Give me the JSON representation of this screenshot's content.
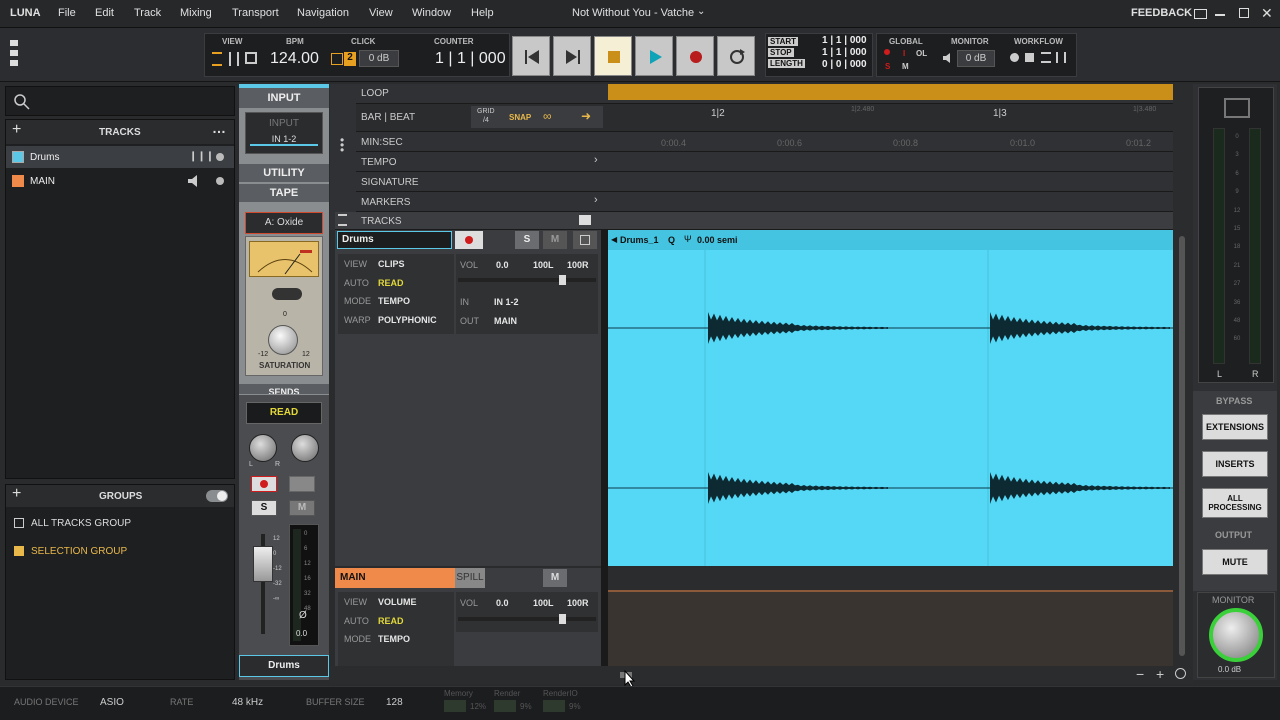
{
  "menu": {
    "app": "LUNA",
    "items": [
      "File",
      "Edit",
      "Track",
      "Mixing",
      "Transport",
      "Navigation",
      "View",
      "Window",
      "Help"
    ],
    "title": "Not Without You - Vatche",
    "feedback": "FEEDBACK"
  },
  "transport": {
    "view_label": "VIEW",
    "bpm_label": "BPM",
    "bpm": "124.00",
    "click_label": "CLICK",
    "click_value": "0 dB",
    "click_num": "2",
    "counter_label": "COUNTER",
    "counter": "1 | 1 | 000",
    "start_label": "START",
    "stop_label": "STOP",
    "length_label": "LENGTH",
    "start": "1 | 1 | 000",
    "stop": "1 | 1 | 000",
    "length": "0 | 0 | 000",
    "global_label": "GLOBAL",
    "global_s": "S",
    "global_m": "M",
    "global_i": "I",
    "global_ol": "OL",
    "monitor_label": "MONITOR",
    "monitor_value": "0 dB",
    "workflow_label": "WORKFLOW"
  },
  "left": {
    "tracks_header": "TRACKS",
    "tracks": [
      {
        "name": "Drums",
        "color": "#5bc8e8"
      },
      {
        "name": "MAIN",
        "color": "#f08a4b"
      }
    ],
    "groups_header": "GROUPS",
    "groups": [
      {
        "name": "ALL TRACKS GROUP",
        "color": "#dddddd"
      },
      {
        "name": "SELECTION GROUP",
        "color": "#e8b84a"
      }
    ]
  },
  "strip": {
    "input_label": "INPUT",
    "input_slot": "INPUT",
    "input_value": "IN 1-2",
    "utility_label": "UTILITY",
    "tape_label": "TAPE",
    "tape_name": "A: Oxide",
    "saturation_label": "SATURATION",
    "sat_min": "-12",
    "sat_max": "12",
    "sat_zero": "0",
    "sends_label": "SENDS",
    "read_label": "READ",
    "s_label": "S",
    "m_label": "M",
    "fader_value": "0.0",
    "fader_scale": [
      "0",
      "6",
      "12",
      "16",
      "32",
      "48"
    ],
    "fader_scale_left": [
      "12",
      "0",
      "-12",
      "-32",
      "-∞"
    ],
    "phase": "Ø",
    "track_name": "Drums",
    "pan_l": "L",
    "pan_r": "R"
  },
  "ruler": {
    "loop": "LOOP",
    "bar_beat": "BAR | BEAT",
    "grid_label": "GRID",
    "grid_value": "/4",
    "snap": "SNAP",
    "min_sec": "MIN:SEC",
    "tempo": "TEMPO",
    "signature": "SIGNATURE",
    "markers": "MARKERS",
    "tracks": "TRACKS",
    "bar_ticks": [
      "1|2",
      "1|2.480",
      "1|3",
      "1|3.480"
    ],
    "sec_ticks": [
      "0:00.4",
      "0:00.6",
      "0:00.8",
      "0:01.0",
      "0:01.2"
    ]
  },
  "drums_track": {
    "name": "Drums",
    "s": "S",
    "m": "M",
    "view_label": "VIEW",
    "view": "CLIPS",
    "auto_label": "AUTO",
    "auto": "READ",
    "mode_label": "MODE",
    "mode": "TEMPO",
    "warp_label": "WARP",
    "warp": "POLYPHONIC",
    "vol_label": "VOL",
    "vol": "0.0",
    "pan_l": "100L",
    "pan_r": "100R",
    "in_label": "IN",
    "in": "IN 1-2",
    "out_label": "OUT",
    "out": "MAIN",
    "clip_name": "Drums_1",
    "clip_q": "Q",
    "clip_semi": "0.00 semi"
  },
  "main_track": {
    "name": "MAIN",
    "spill": "SPILL",
    "m": "M",
    "view_label": "VIEW",
    "view": "VOLUME",
    "auto_label": "AUTO",
    "auto": "READ",
    "mode_label": "MODE",
    "mode": "TEMPO",
    "vol_label": "VOL",
    "vol": "0.0",
    "pan_l": "100L",
    "pan_r": "100R"
  },
  "right": {
    "meter_scale": [
      "0",
      "3",
      "6",
      "9",
      "12",
      "15",
      "18",
      "21",
      "27",
      "36",
      "48",
      "60"
    ],
    "l": "L",
    "r": "R",
    "bypass": "BYPASS",
    "extensions": "EXTENSIONS",
    "inserts": "INSERTS",
    "all_processing": "ALL PROCESSING",
    "output": "OUTPUT",
    "mute": "MUTE",
    "monitor": "MONITOR",
    "monitor_value": "0.0 dB"
  },
  "status": {
    "audio_device_label": "AUDIO DEVICE",
    "audio_device": "ASIO",
    "rate_label": "RATE",
    "rate": "48 kHz",
    "buffer_label": "BUFFER SIZE",
    "buffer": "128",
    "memory_label": "Memory",
    "memory": "12%",
    "render_label": "Render",
    "render": "9%",
    "renderio_label": "RenderIO",
    "renderio": "9%"
  },
  "colors": {
    "clip_bg": "#55d8f5",
    "main_orange": "#f08a4b",
    "loop_bar": "#c98f18",
    "record_red": "#d01c1c",
    "play_teal": "#0fa3b8"
  }
}
